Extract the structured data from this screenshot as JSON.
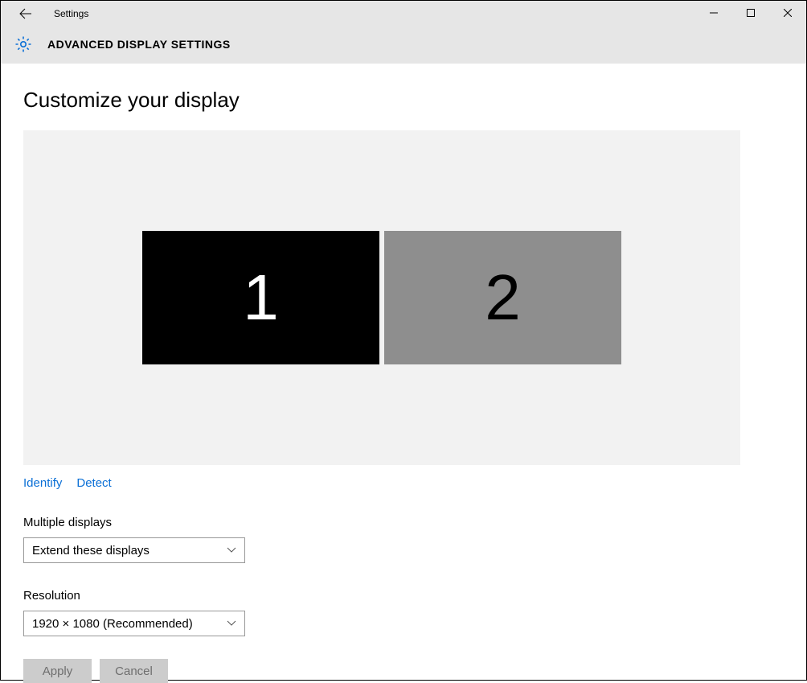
{
  "window": {
    "title": "Settings"
  },
  "page": {
    "header": "ADVANCED DISPLAY SETTINGS",
    "heading": "Customize your display"
  },
  "displays": {
    "monitor1": "1",
    "monitor2": "2"
  },
  "links": {
    "identify": "Identify",
    "detect": "Detect"
  },
  "fields": {
    "multiple_label": "Multiple displays",
    "multiple_value": "Extend these displays",
    "resolution_label": "Resolution",
    "resolution_value": "1920 × 1080 (Recommended)"
  },
  "buttons": {
    "apply": "Apply",
    "cancel": "Cancel"
  }
}
